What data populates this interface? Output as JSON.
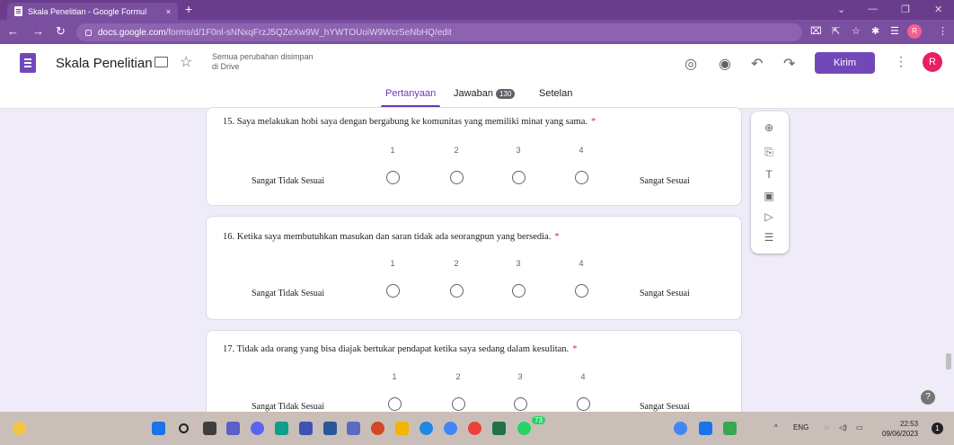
{
  "browser": {
    "tab_title": "Skala Penelitian - Google Formul",
    "tab_close": "×",
    "new_tab": "+",
    "url_host": "docs.google.com",
    "url_path": "/forms/d/1F0nl-sNNxqFrzJ5QZeXw9W_hYWTOUoiW9WcrSeNbHQ/edit",
    "profile_letter": "R",
    "min": "⌄",
    "min2": "—",
    "restore": "❐",
    "close": "✕"
  },
  "header": {
    "title": "Skala Penelitian",
    "save_status_line1": "Semua perubahan disimpan",
    "save_status_line2": "di Drive",
    "send_label": "Kirim",
    "avatar_letter": "R"
  },
  "form_tabs": {
    "questions": "Pertanyaan",
    "responses": "Jawaban",
    "responses_count": "130",
    "settings": "Setelan"
  },
  "questions": [
    {
      "title": "15.  Saya melakukan hobi saya dengan bergabung ke komunitas yang memiliki minat yang sama.",
      "required": "*",
      "scale": [
        "1",
        "2",
        "3",
        "4"
      ],
      "low_label": "Sangat Tidak Sesuai",
      "high_label": "Sangat Sesuai"
    },
    {
      "title": "16.  Ketika saya membutuhkan masukan dan saran tidak ada seorangpun yang bersedia.",
      "required": "*",
      "scale": [
        "1",
        "2",
        "3",
        "4"
      ],
      "low_label": "Sangat Tidak Sesuai",
      "high_label": "Sangat Sesuai"
    },
    {
      "title": "17.  Tidak ada orang yang bisa diajak bertukar pendapat ketika saya sedang dalam kesulitan.",
      "required": "*",
      "scale": [
        "1",
        "2",
        "3",
        "4"
      ],
      "low_label": "Sangat Tidak Sesuai",
      "high_label": "Sangat Sesuai"
    }
  ],
  "taskbar": {
    "lang": "ENG",
    "time": "22:53",
    "date": "09/06/2023",
    "notif_count": "1",
    "chat_badge": "73"
  }
}
